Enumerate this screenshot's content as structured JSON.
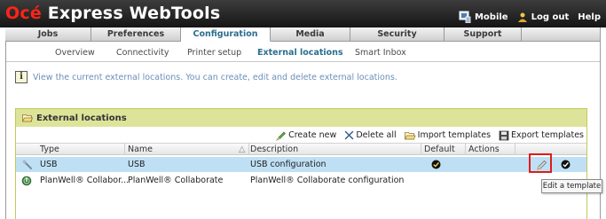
{
  "header": {
    "brand_oce": "Océ",
    "brand_rest": " Express WebTools",
    "links": [
      {
        "label": "Mobile",
        "icon": "mobile-icon"
      },
      {
        "label": "Log out",
        "icon": "logout-icon"
      },
      {
        "label": "Help"
      }
    ]
  },
  "tabs": [
    "Jobs",
    "Preferences",
    "Configuration",
    "Media",
    "Security",
    "Support",
    ""
  ],
  "active_tab": "Configuration",
  "subtabs": [
    "Overview",
    "Connectivity",
    "Printer setup",
    "External locations",
    "Smart Inbox"
  ],
  "active_subtab": "External locations",
  "info": {
    "icon": "info-icon",
    "text": "View the current external locations. You can create, edit and delete external locations."
  },
  "panel": {
    "title": "External locations",
    "toolbar": {
      "create_new": "Create new",
      "delete_all": "Delete all",
      "import_templates": "Import templates",
      "export_templates": "Export templates"
    },
    "columns": {
      "type": "Type",
      "name": "Name",
      "description": "Description",
      "default": "Default",
      "actions": "Actions"
    },
    "rows": [
      {
        "type": "USB",
        "name": "USB",
        "description": "USB configuration",
        "default": true,
        "selected": true,
        "icon": "usb-icon"
      },
      {
        "type": "PlanWell® Collabor...",
        "name": "PlanWell® Collaborate",
        "description": "PlanWell® Collaborate configuration",
        "default": false,
        "selected": false,
        "icon": "planwell-icon"
      }
    ]
  },
  "tooltip": "Edit a template",
  "colors": {
    "brand_red": "#ff2419",
    "active_tab_text": "#2a6f8e",
    "panel_header": "#dde49a",
    "selected_row": "#bfe0f4",
    "highlight": "#e01b1b"
  }
}
